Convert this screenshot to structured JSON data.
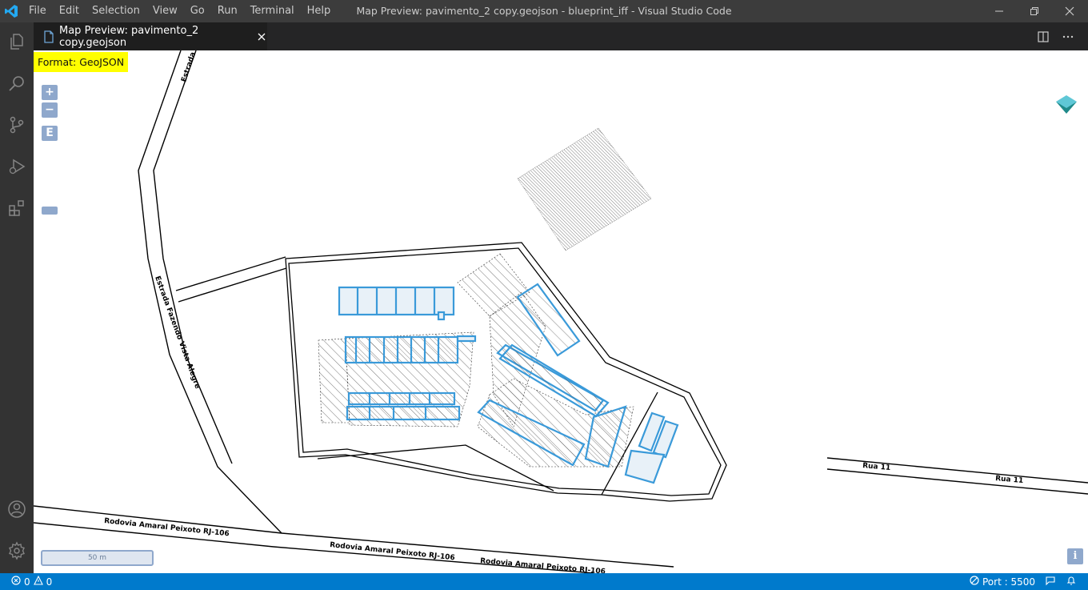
{
  "titlebar": {
    "menu": [
      "File",
      "Edit",
      "Selection",
      "View",
      "Go",
      "Run",
      "Terminal",
      "Help"
    ],
    "window_title": "Map Preview: pavimento_2 copy.geojson - blueprint_iff - Visual Studio Code"
  },
  "activitybar": {
    "icons": [
      "explorer-icon",
      "search-icon",
      "source-control-icon",
      "run-debug-icon",
      "extensions-icon",
      "account-icon",
      "settings-gear-icon"
    ]
  },
  "tab": {
    "label": "Map Preview: pavimento_2 copy.geojson"
  },
  "map": {
    "format_badge": "Format: GeoJSON",
    "zoom_in": "+",
    "zoom_out": "−",
    "extent": "E",
    "scale": "50 m",
    "info": "i",
    "road_labels": {
      "estrada_top": "Estrada F",
      "estrada_fazendo": "Estrada Fazendo Vista Alegre",
      "rodovia_1": "Rodovia Amaral Peixoto RJ-106",
      "rodovia_2": "Rodovia Amaral Peixoto RJ-106",
      "rodovia_3": "Rodovia Amaral Peixoto RJ-106",
      "rua_11_a": "Rua 11",
      "rua_11_b": "Rua 11"
    },
    "colors": {
      "building_stroke": "#3a9ad9",
      "building_fill": "#e3eef6",
      "control": "#8fa8cc",
      "badge": "#ffff00"
    }
  },
  "statusbar": {
    "errors": "0",
    "warnings": "0",
    "port": "Port : 5500"
  }
}
